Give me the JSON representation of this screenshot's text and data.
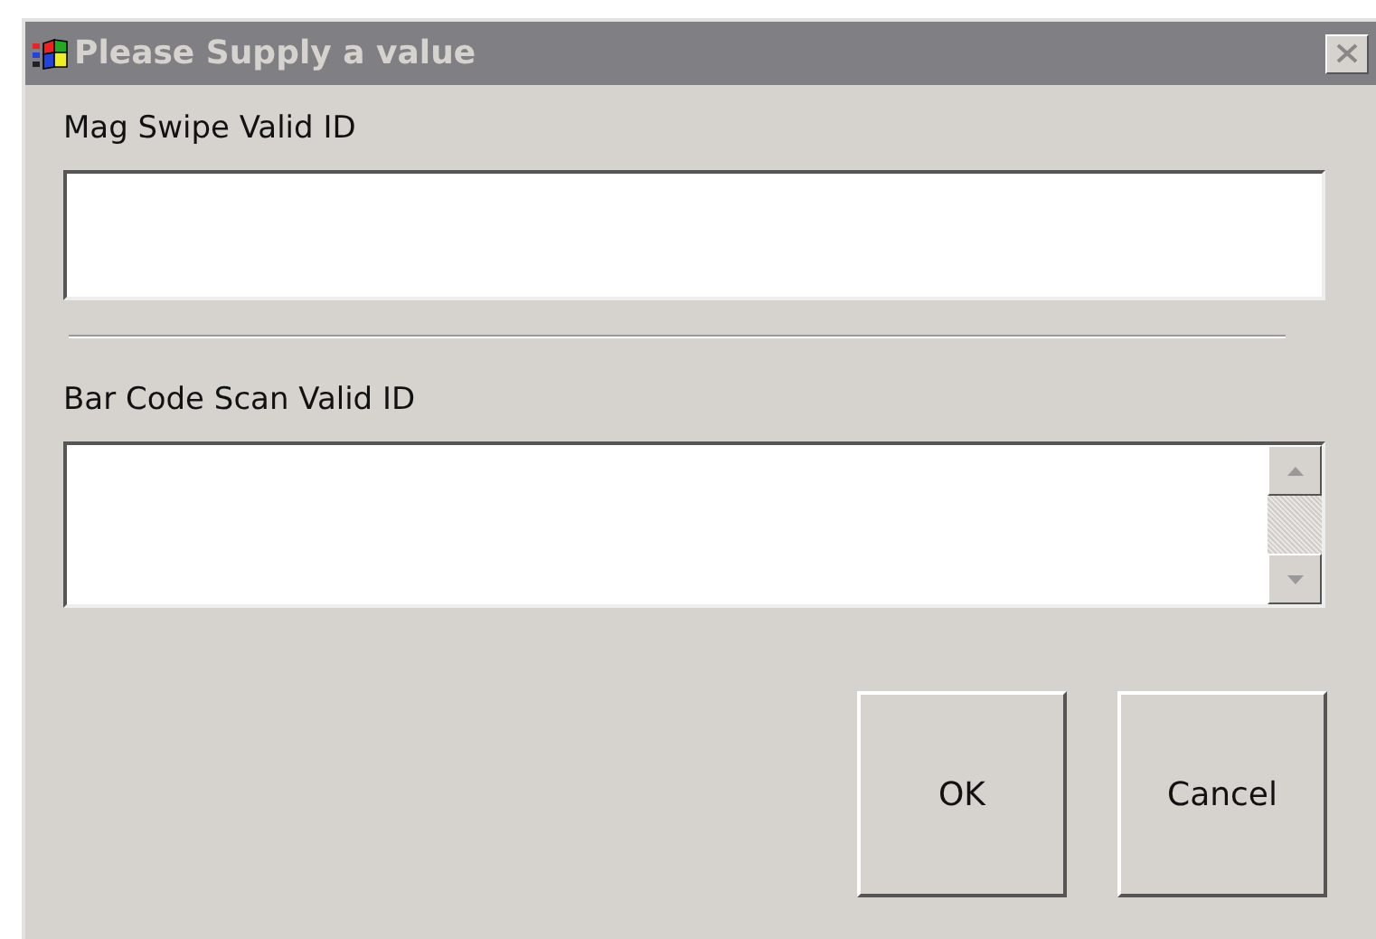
{
  "window": {
    "title": "Please Supply a value"
  },
  "fields": [
    {
      "label": "Mag Swipe Valid ID",
      "kind": "text"
    },
    {
      "label": "Bar Code Scan Valid ID",
      "kind": "textarea"
    }
  ],
  "buttons": [
    "OK",
    "Cancel"
  ]
}
